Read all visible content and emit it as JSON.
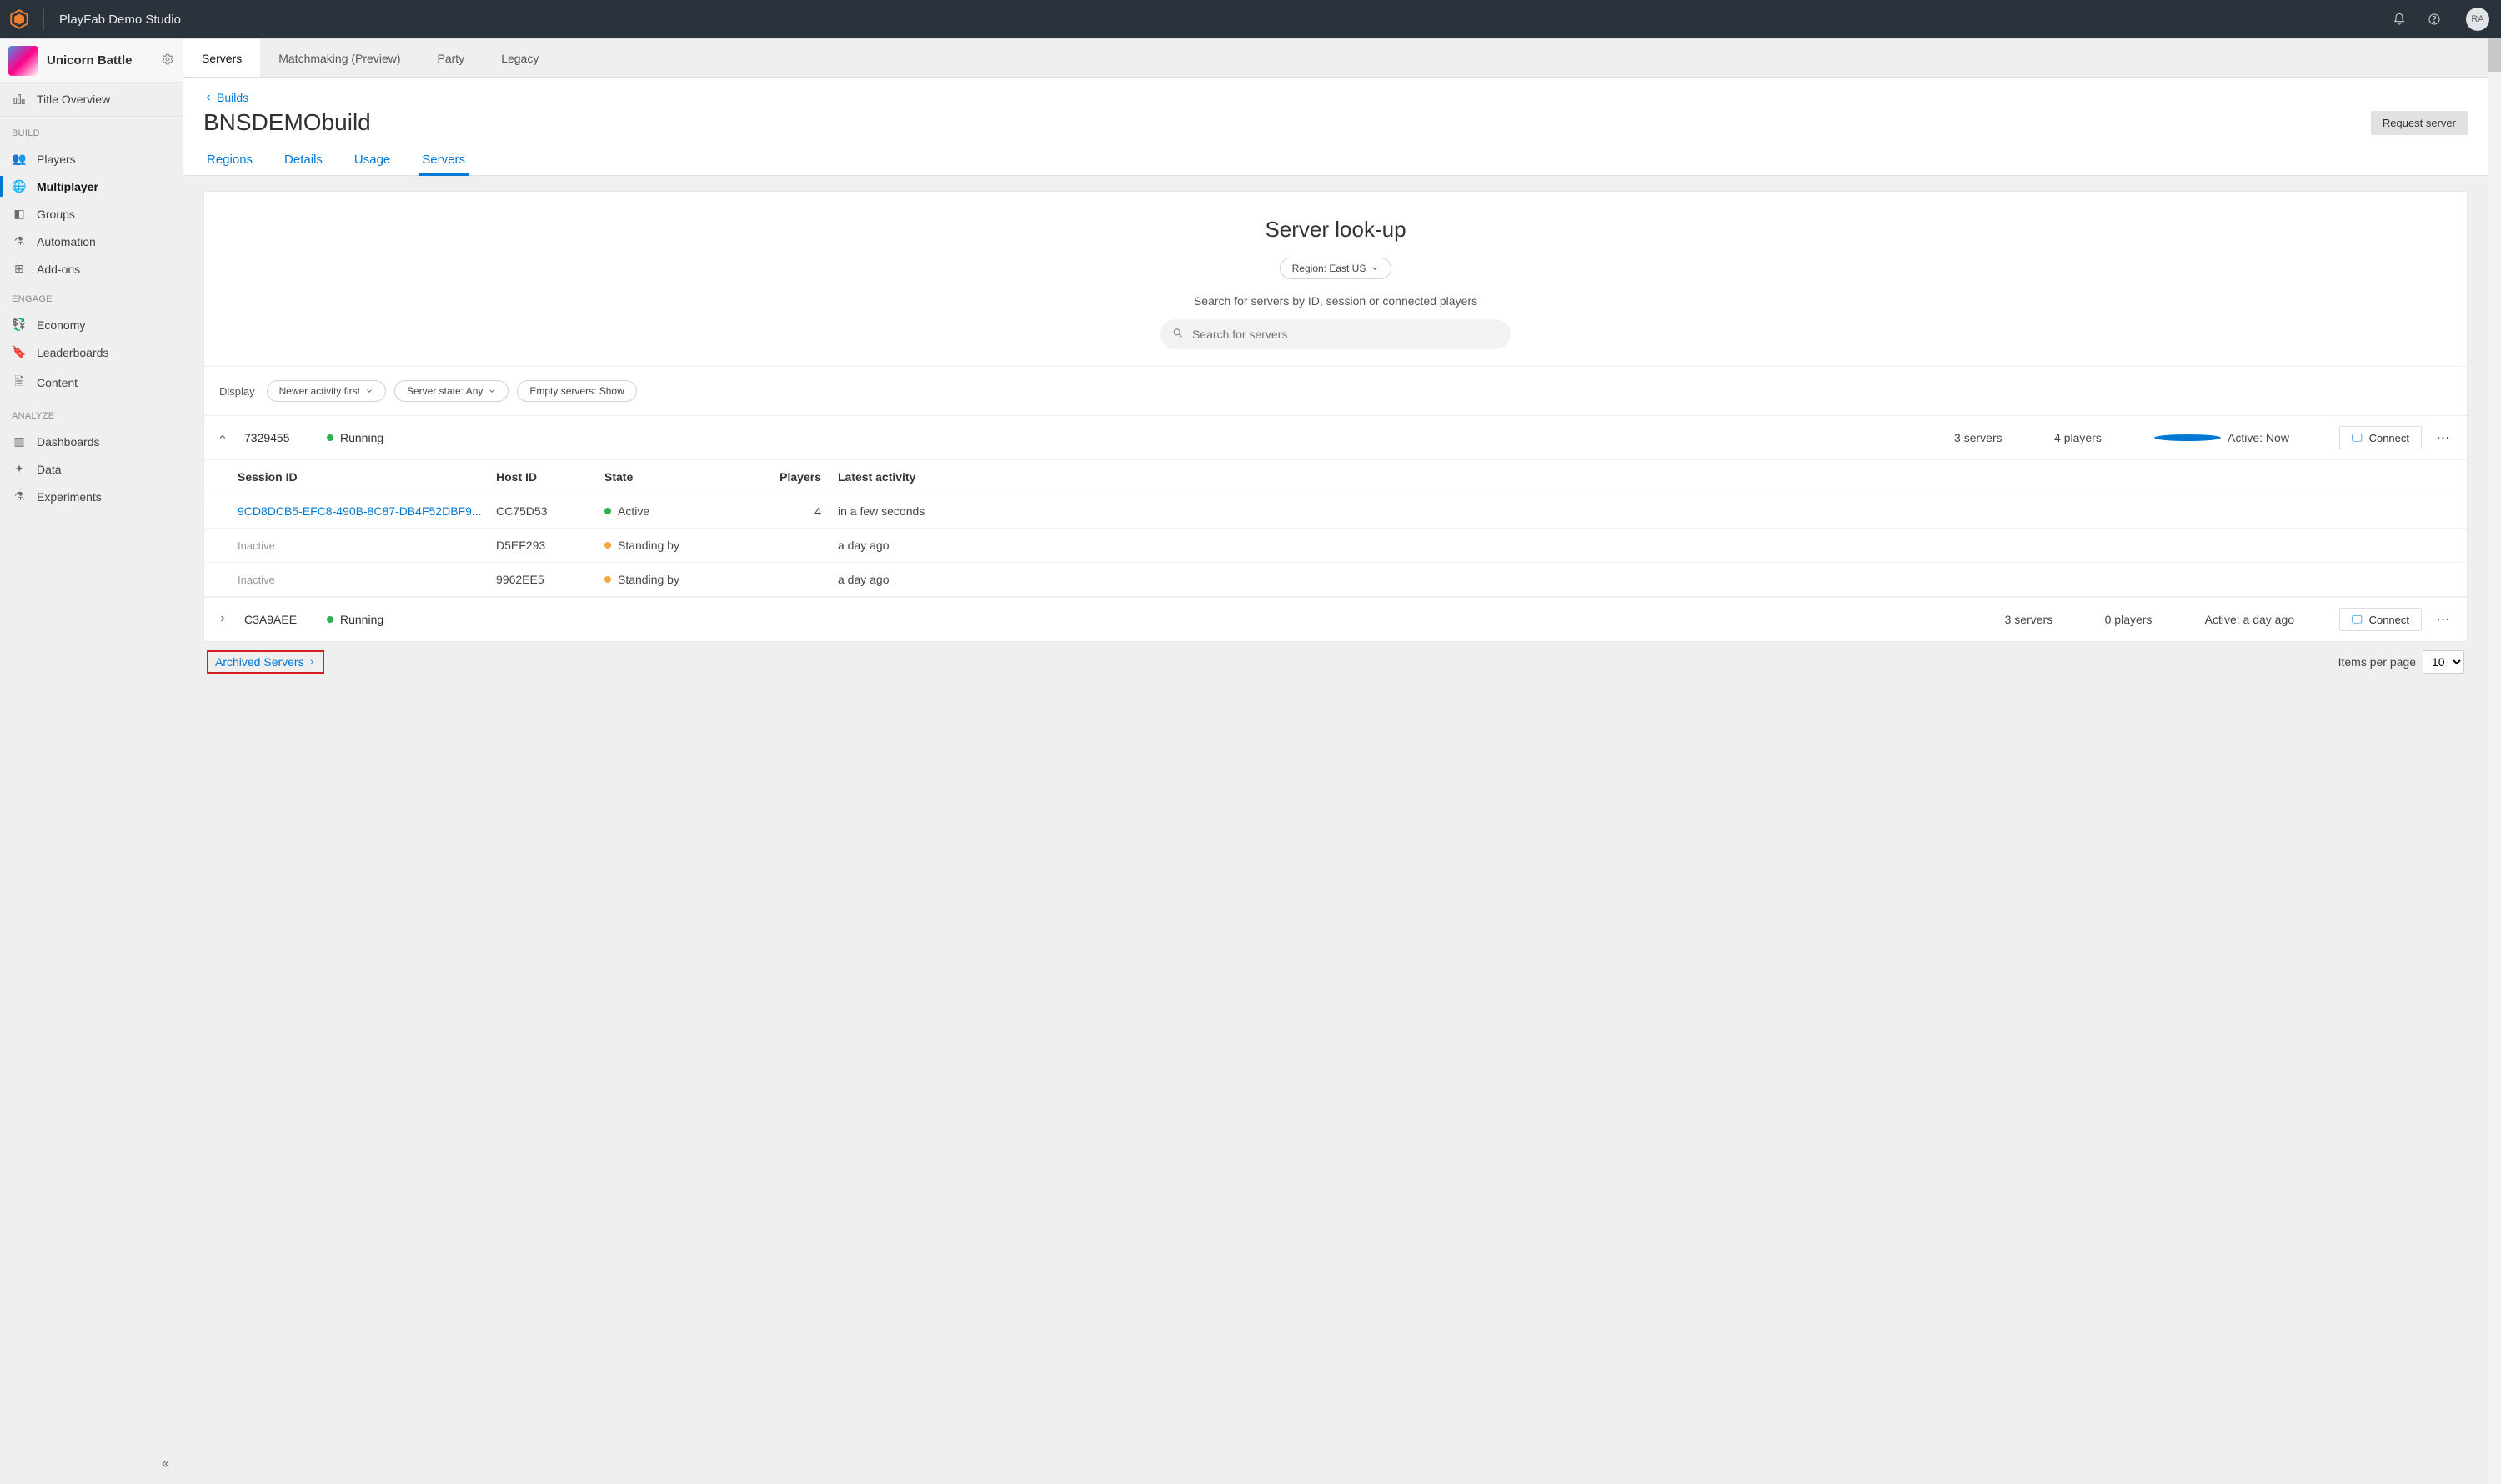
{
  "brand": "PlayFab Demo Studio",
  "avatar": "RA",
  "title": {
    "name": "Unicorn Battle"
  },
  "sidebar": {
    "overview": "Title Overview",
    "sections": {
      "build": {
        "label": "BUILD",
        "items": [
          "Players",
          "Multiplayer",
          "Groups",
          "Automation",
          "Add-ons"
        ]
      },
      "engage": {
        "label": "ENGAGE",
        "items": [
          "Economy",
          "Leaderboards",
          "Content"
        ]
      },
      "analyze": {
        "label": "ANALYZE",
        "items": [
          "Dashboards",
          "Data",
          "Experiments"
        ]
      }
    }
  },
  "top_tabs": [
    "Servers",
    "Matchmaking (Preview)",
    "Party",
    "Legacy"
  ],
  "breadcrumb": "Builds",
  "page_title": "BNSDEMObuild",
  "request_btn": "Request server",
  "sub_tabs": [
    "Regions",
    "Details",
    "Usage",
    "Servers"
  ],
  "lookup": {
    "heading": "Server look-up",
    "region_pill": "Region: East US",
    "hint": "Search for servers by ID, session or connected players",
    "search_placeholder": "Search for servers"
  },
  "display": {
    "label": "Display",
    "sort": "Newer activity first",
    "state": "Server state: Any",
    "empty": "Empty servers: Show"
  },
  "table": {
    "headers": {
      "session": "Session ID",
      "host": "Host ID",
      "state": "State",
      "players": "Players",
      "latest": "Latest activity"
    },
    "connect": "Connect"
  },
  "vm1": {
    "id": "7329455",
    "status": "Running",
    "servers": "3 servers",
    "players": "4 players",
    "active": "Active: Now",
    "rows": [
      {
        "sid": "9CD8DCB5-EFC8-490B-8C87-DB4F52DBF9...",
        "host": "CC75D53",
        "state": "Active",
        "state_dot": "green",
        "players": "4",
        "latest": "in a few seconds",
        "link": true
      },
      {
        "sid": "Inactive",
        "host": "D5EF293",
        "state": "Standing by",
        "state_dot": "orange",
        "players": "",
        "latest": "a day ago",
        "link": false
      },
      {
        "sid": "Inactive",
        "host": "9962EE5",
        "state": "Standing by",
        "state_dot": "orange",
        "players": "",
        "latest": "a day ago",
        "link": false
      }
    ]
  },
  "vm2": {
    "id": "C3A9AEE",
    "status": "Running",
    "servers": "3 servers",
    "players": "0 players",
    "active": "Active: a day ago"
  },
  "archived": "Archived Servers",
  "ipp": {
    "label": "Items per page",
    "value": "10"
  }
}
